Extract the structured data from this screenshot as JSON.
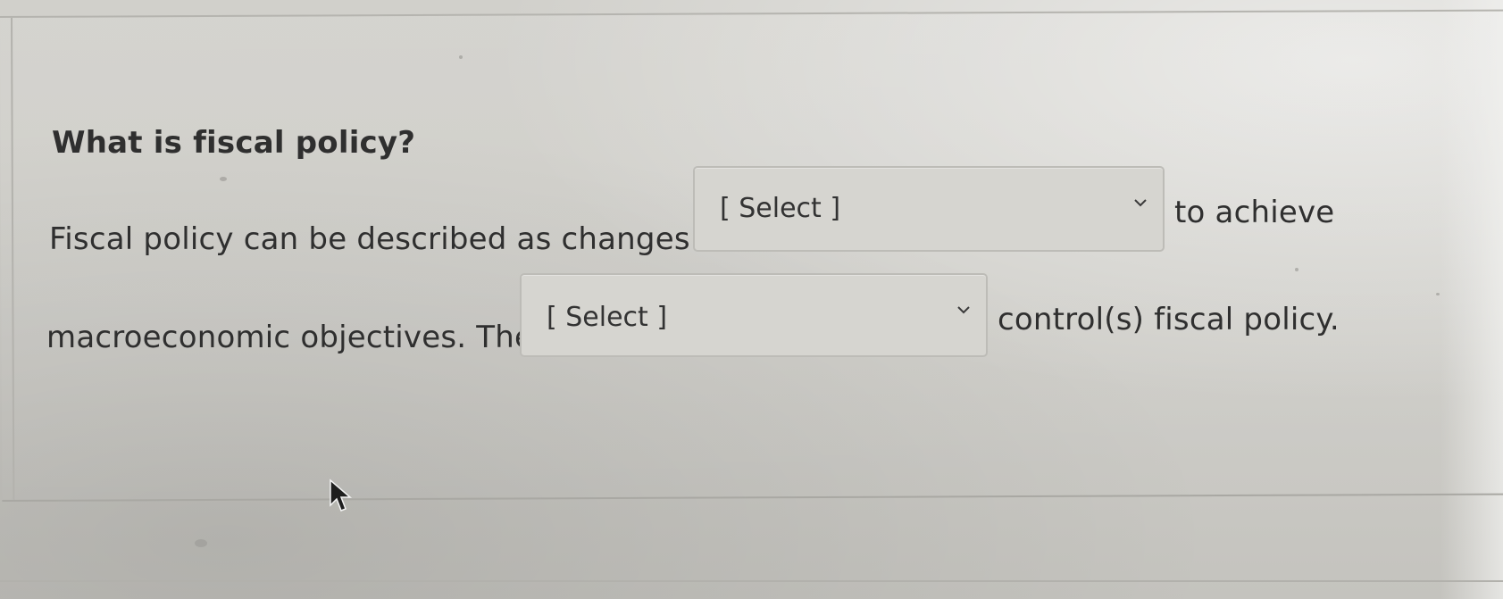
{
  "question": {
    "title": "What is fiscal policy?",
    "line1_prefix": "Fiscal policy can be described as changes in",
    "line1_suffix": "to achieve",
    "line2_prefix": "macroeconomic objectives. The",
    "line2_suffix": "control(s) fiscal policy."
  },
  "dropdowns": {
    "first": {
      "selected": "[ Select ]",
      "icon": "chevron-down-icon"
    },
    "second": {
      "selected": "[ Select ]",
      "icon": "chevron-down-icon"
    }
  },
  "pointer": {
    "icon": "mouse-cursor-icon"
  }
}
